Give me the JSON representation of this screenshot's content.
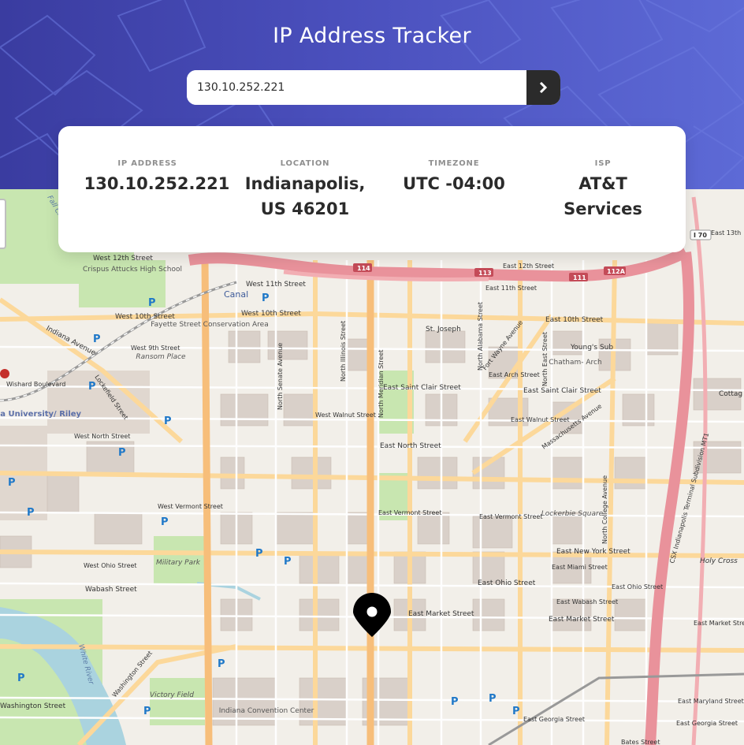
{
  "header": {
    "title": "IP Address Tracker",
    "search": {
      "value": "130.10.252.221"
    }
  },
  "info": [
    {
      "label": "IP ADDRESS",
      "value": "130.10.252.221"
    },
    {
      "label": "LOCATION",
      "value": "Indianapolis, US 46201"
    },
    {
      "label": "TIMEZONE",
      "value": "UTC -04:00"
    },
    {
      "label": "ISP",
      "value": "AT&T Services"
    }
  ],
  "map_labels": {
    "west_12th": "West 12th Street",
    "west_11th": "West 11th Street",
    "canal": "Canal",
    "west_10th_a": "West 10th Street",
    "west_10th_b": "West 10th Street",
    "crispus": "Crispus Attucks High School",
    "fayette": "Fayette Street Conservation Area",
    "ransom": "Ransom Place",
    "indiana_ave": "Indiana Avenue",
    "west_9th": "West 9th Street",
    "wishard": "Wishard Boulevard",
    "lockefield": "Lockefield Street",
    "iu": "Indiana University/ Riley",
    "west_north": "West North Street",
    "west_walnut": "West Walnut Street",
    "west_vermont": "West Vermont Street",
    "west_ohio": "West Ohio Street",
    "wabash": "Wabash Street",
    "military": "Military Park",
    "victory": "Victory Field",
    "convention": "Indiana Convention Center",
    "washington": "Washington Street",
    "white_river": "White River",
    "east_12th": "East 12th Street",
    "east_11th": "East 11th Street",
    "east_10th": "East 10th Street",
    "st_joseph": "St. Joseph",
    "youngs_sub": "Young's Sub",
    "chatham": "Chatham- Arch",
    "east_arch": "East Arch Street",
    "east_st_clair": "East Saint Clair Street",
    "east_st_clair_b": "East Saint Clair Street",
    "east_walnut": "East Walnut Street",
    "east_north": "East North Street",
    "mass_ave": "Massachusetts Avenue",
    "east_vermont": "East Vermont Street",
    "east_vermont_b": "East Vermont Street",
    "lockerbie": "Lockerbie Square",
    "east_new_york": "East New York Street",
    "east_miami": "East Miami Street",
    "east_ohio": "East Ohio Street",
    "east_ohio_b": "East Ohio Street",
    "east_wabash": "East Wabash Street",
    "east_market": "East Market Street",
    "east_market_b": "East Market Street",
    "east_market_c": "East Market Street",
    "east_maryland": "East Maryland Street",
    "east_georgia": "East Georgia Street",
    "east_georgia_b": "East Georgia Street",
    "bates": "Bates Street",
    "holy_cross": "Holy Cross",
    "csx": "CSX Indianapolis Terminal Subdivision MT1",
    "meridian": "North Meridian Street",
    "illinois": "North Illinois Street",
    "senate": "North Senate Avenue",
    "alabama": "North Alabama Street",
    "fort_wayne": "Fort Wayne Avenue",
    "east_st": "North East Street",
    "college": "North College Avenue",
    "i70": "I 70",
    "exit_114": "114",
    "exit_113": "113",
    "exit_111": "111",
    "exit_112a": "112A",
    "fall_creek": "Fall Creek",
    "east_13th": "East 13th",
    "cottage": "Cottag"
  },
  "colors": {
    "header_dark": "#3a3ca0",
    "header_light": "#5d6ad6",
    "text_dark": "#2b2b2b",
    "label_gray": "#8f8f8f"
  }
}
